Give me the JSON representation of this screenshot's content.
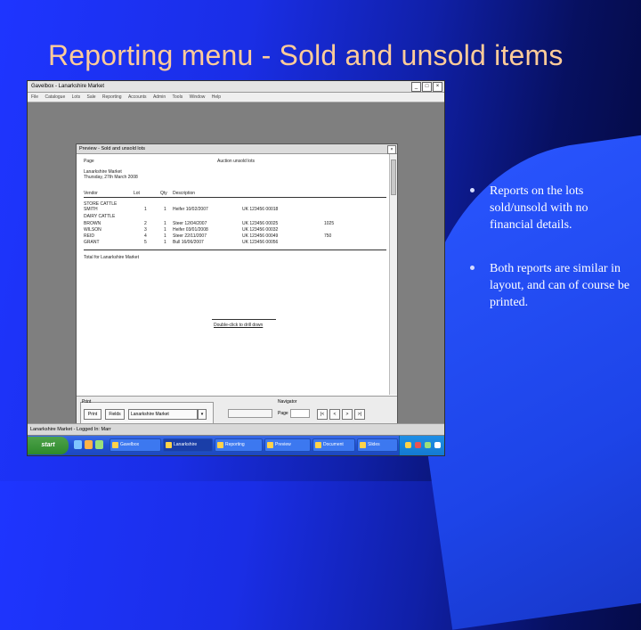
{
  "slide": {
    "title": "Reporting menu - Sold and unsold items",
    "bullets": [
      {
        "text": "Reports on the lots sold/unsold with no financial details."
      },
      {
        "text": "Both reports are similar in layout, and can of course be printed."
      }
    ]
  },
  "screenshot": {
    "app_title": "Gavelbox - Lanarkshire Market",
    "window_buttons": [
      "_",
      "□",
      "×"
    ],
    "menu_items": [
      "File",
      "Catalogue",
      "Lots",
      "Sale",
      "Reporting",
      "Accounts",
      "Admin",
      "Tools",
      "Window",
      "Help"
    ],
    "status_text": "Lanarkshire Market  - Logged In: Marr",
    "preview": {
      "title": "Preview - Sold and unsold lots",
      "close": "×",
      "report": {
        "header_left": "Page",
        "header_center": "Auction unsold lots",
        "market": "Lanarkshire Market",
        "date": "Thursday, 27th March 2008",
        "columns": [
          "Vendor",
          "Lot",
          "Qty",
          "Description"
        ],
        "groups": [
          "STORE CATTLE",
          "DAIRY CATTLE"
        ],
        "rows": [
          {
            "vendor": "SMITH",
            "lot": "1",
            "qty": "1",
            "desc": "Heifer 10/02/2007",
            "tag": "UK 123456 00018",
            "price": ""
          },
          {
            "vendor": "BROWN",
            "lot": "2",
            "qty": "1",
            "desc": "Steer 12/04/2007",
            "tag": "UK 123456 00025",
            "price": "1025"
          },
          {
            "vendor": "WILSON",
            "lot": "3",
            "qty": "1",
            "desc": "Heifer 03/01/2008",
            "tag": "UK 123456 00032",
            "price": ""
          },
          {
            "vendor": "REID",
            "lot": "4",
            "qty": "1",
            "desc": "Steer 22/11/2007",
            "tag": "UK 123456 00049",
            "price": "750"
          },
          {
            "vendor": "GRANT",
            "lot": "5",
            "qty": "1",
            "desc": "Bull 16/06/2007",
            "tag": "UK 123456 00056",
            "price": ""
          }
        ],
        "total": "Total for Lanarkshire Market",
        "footer_link": "Double-click to drill down"
      },
      "footer": {
        "group_label": "Print",
        "print_button": "Print",
        "fields_button": "Fields",
        "select_value": "Lanarkshire Market",
        "navigator_label": "Navigator",
        "page_label": "Page"
      }
    },
    "taskbar": {
      "start": "start",
      "items": [
        "Gavelbox",
        "Lanarkshire",
        "Reporting",
        "Preview",
        "Document",
        "Slides"
      ]
    }
  }
}
